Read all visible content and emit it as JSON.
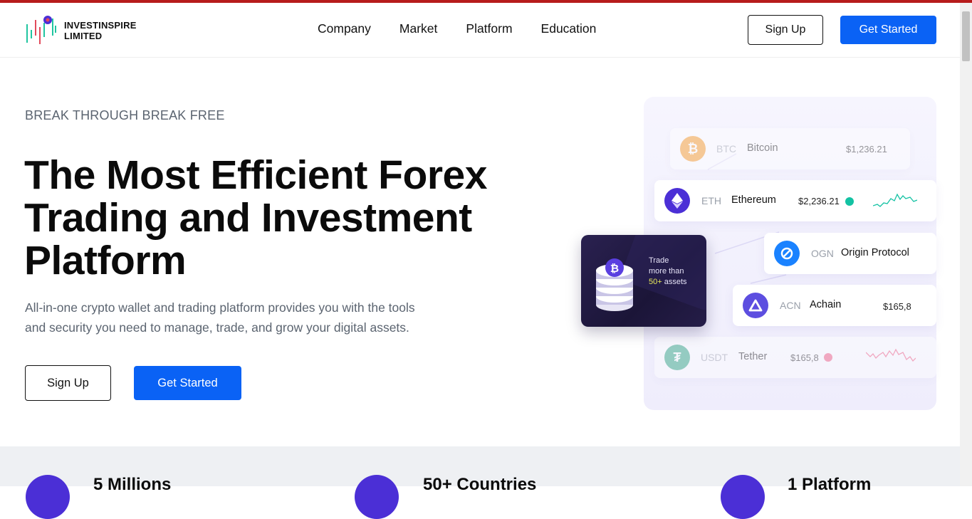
{
  "brand": {
    "line1": "INVESTINSPIRE",
    "line2": "LIMITED"
  },
  "nav": {
    "items": [
      "Company",
      "Market",
      "Platform",
      "Education"
    ]
  },
  "header": {
    "signup_label": "Sign Up",
    "get_started_label": "Get Started"
  },
  "hero": {
    "eyebrow": "BREAK THROUGH BREAK FREE",
    "headline_line1": "The Most Efficient Forex",
    "headline_line2": "Trading and Investment",
    "headline_line3": "Platform",
    "description_line1": "All-in-one crypto wallet and trading platform provides you with the tools",
    "description_line2": "and security you need to manage, trade, and grow your digital assets.",
    "signup_label": "Sign Up",
    "get_started_label": "Get Started"
  },
  "coins": [
    {
      "symbol": "BTC",
      "name": "Bitcoin",
      "price": "$1,236.21",
      "color": "#f7931a",
      "icon": "bitcoin-icon"
    },
    {
      "symbol": "ETH",
      "name": "Ethereum",
      "price": "$2,236.21",
      "color": "#4b2fd6",
      "icon": "ethereum-icon",
      "trend": "up"
    },
    {
      "symbol": "OGN",
      "name": "Origin Protocol",
      "color": "#1a82ff",
      "icon": "origin-protocol-icon"
    },
    {
      "symbol": "ACN",
      "name": "Achain",
      "price": "$165,8",
      "color": "#5d4ee0",
      "icon": "achain-icon"
    },
    {
      "symbol": "USDT",
      "name": "Tether",
      "price": "$165,8",
      "color": "#26a17b",
      "icon": "tether-icon",
      "trend": "down"
    }
  ],
  "promo": {
    "line1": "Trade",
    "line2": "more than",
    "highlight": "50+",
    "line3": " assets"
  },
  "stats": [
    {
      "label": "5 Millions"
    },
    {
      "label": "50+ Countries"
    },
    {
      "label": "1 Platform"
    }
  ],
  "colors": {
    "accent": "#0a62f5",
    "topbar": "#b71c1c",
    "purple": "#4b2fd6",
    "up": "#13c2a3",
    "down": "#f0557a"
  }
}
